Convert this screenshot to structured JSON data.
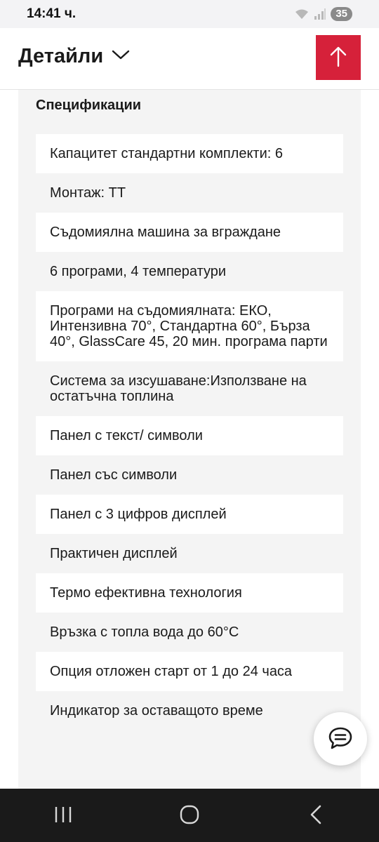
{
  "status_bar": {
    "time": "14:41 ч.",
    "battery": "35",
    "icons": [
      "wifi-icon",
      "signal-icon"
    ]
  },
  "header": {
    "title": "Детайли",
    "dropdown_icon": "chevron-down-icon",
    "scroll_top_icon": "arrow-up-icon",
    "accent_color": "#d6213a"
  },
  "specs": {
    "heading": "Спецификации",
    "items": [
      "Капацитет стандартни комплекти: 6",
      "Монтаж: TT",
      "Съдомиялна машина за вграждане",
      "6 програми, 4 температури",
      "Програми на съдомиялната: ЕКО, Интензивна 70°, Стандартна 60°, Бърза 40°, GlassCare 45, 20 мин. програма парти",
      "Система за изсушаване:Използване на остатъчна топлина",
      "Панел с текст/ символи",
      "Панел със символи",
      "Панел с 3 цифров дисплей",
      "Практичен дисплей",
      "Термо ефективна технология",
      "Връзка с топла вода до 60°C",
      "Опция отложен старт от 1 до 24 часа",
      "Индикатор за оставащото време"
    ]
  },
  "chat_icon": "chat-bubble-icon",
  "nav": {
    "recent_icon": "recent-apps-icon",
    "home_icon": "home-icon",
    "back_icon": "back-icon"
  }
}
